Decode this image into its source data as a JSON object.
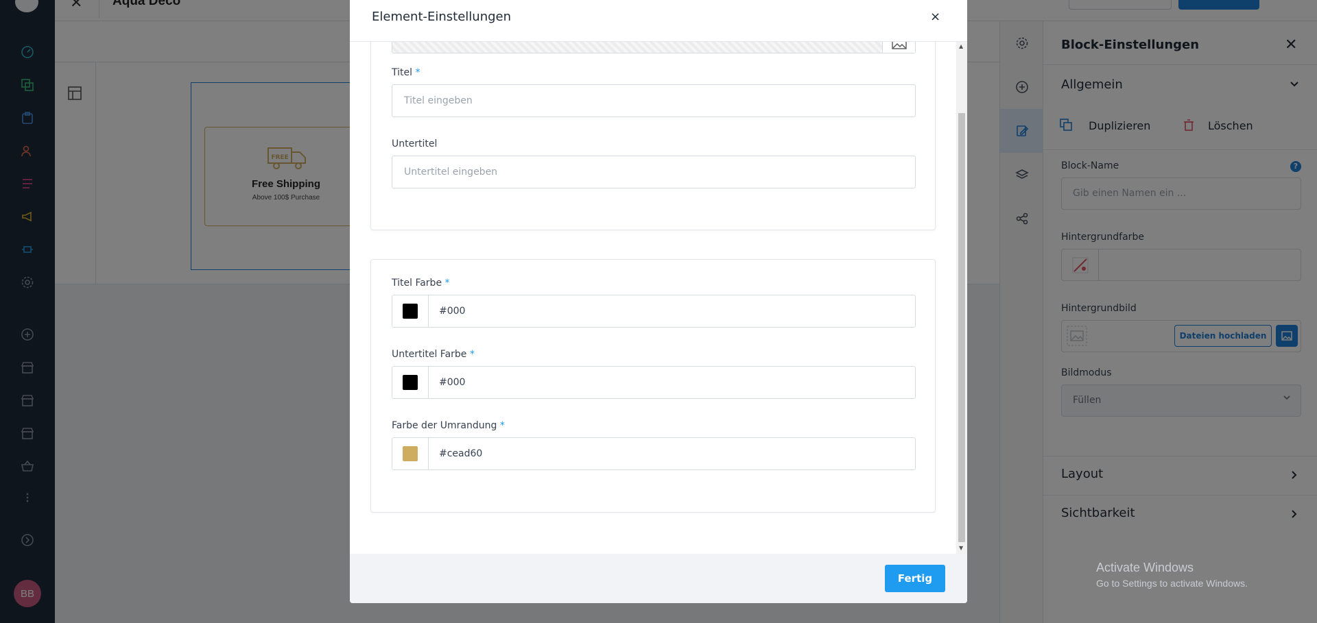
{
  "leftnav": {
    "avatar_initials": "BB",
    "icons": [
      "dashboard-icon",
      "copy-icon",
      "clipboard-icon",
      "users-icon",
      "list-icon",
      "megaphone-icon",
      "plugin-icon",
      "gear-icon",
      "plus-circle-icon",
      "store-icon",
      "store-icon",
      "store-icon",
      "basket-icon",
      "more-icon",
      "chevron-right-circle-icon"
    ]
  },
  "topbar": {
    "title_fragment": "Aqua Deco"
  },
  "canvas": {
    "card_title": "Free Shipping",
    "card_subtitle": "Above 100$ Purchase",
    "card_icon_text": "FREE",
    "accent": "#cead60"
  },
  "modal": {
    "title": "Element-Einstellungen",
    "close_glyph": "×",
    "fields": {
      "titel_label": "Titel",
      "titel_placeholder": "Titel eingeben",
      "untertitel_label": "Untertitel",
      "untertitel_placeholder": "Untertitel eingeben",
      "titel_farbe_label": "Titel Farbe",
      "titel_farbe_value": "#000",
      "untertitel_farbe_label": "Untertitel Farbe",
      "untertitel_farbe_value": "#000",
      "umrandung_label": "Farbe der Umrandung",
      "umrandung_value": "#cead60",
      "required_mark": "*"
    },
    "done_label": "Fertig"
  },
  "rpanel": {
    "title": "Block-Einstellungen",
    "close_glyph": "✕",
    "section_allgemein": "Allgemein",
    "duplicate_label": "Duplizieren",
    "delete_label": "Löschen",
    "block_name_label": "Block-Name",
    "block_name_placeholder": "Gib einen Namen ein ...",
    "help_glyph": "?",
    "bgcolor_label": "Hintergrundfarbe",
    "bgimage_label": "Hintergrundbild",
    "upload_label": "Dateien hochladen",
    "bildmodus_label": "Bildmodus",
    "bildmodus_value": "Füllen",
    "section_layout": "Layout",
    "section_sichtbarkeit": "Sichtbarkeit"
  },
  "watermark": {
    "line1": "Activate Windows",
    "line2": "Go to Settings to activate Windows."
  },
  "colors": {
    "primary": "#1f9bf0",
    "nav_bg": "#1d2b3a",
    "swatch_black": "#000000",
    "swatch_gold": "#cead60"
  }
}
